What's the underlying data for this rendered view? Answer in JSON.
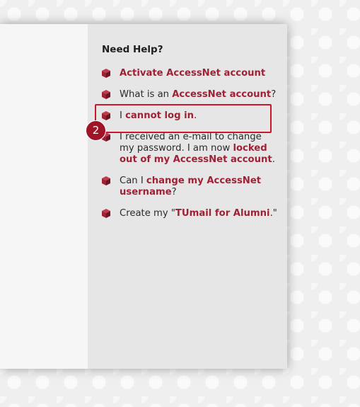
{
  "help": {
    "title": "Need Help?",
    "items": [
      {
        "pre": "",
        "link": "Activate AccessNet account",
        "post": ""
      },
      {
        "pre": "What is an ",
        "link": "AccessNet account",
        "post": "?"
      },
      {
        "pre": "I ",
        "link": "cannot log in",
        "post": "."
      },
      {
        "pre": "I received an e-mail to change my password. I am now ",
        "link": "locked out of my AccessNet account",
        "post": "."
      },
      {
        "pre": "Can I ",
        "link": "change my AccessNet username",
        "post": "?"
      },
      {
        "pre": "Create my \"",
        "link": "TUmail for Alumni",
        "post": ".\""
      }
    ]
  },
  "annotation": {
    "step_number": "2"
  },
  "colors": {
    "link": "#9d2235",
    "highlight": "#c9182b",
    "badge": "#a01427",
    "icon": "#9d2235"
  }
}
